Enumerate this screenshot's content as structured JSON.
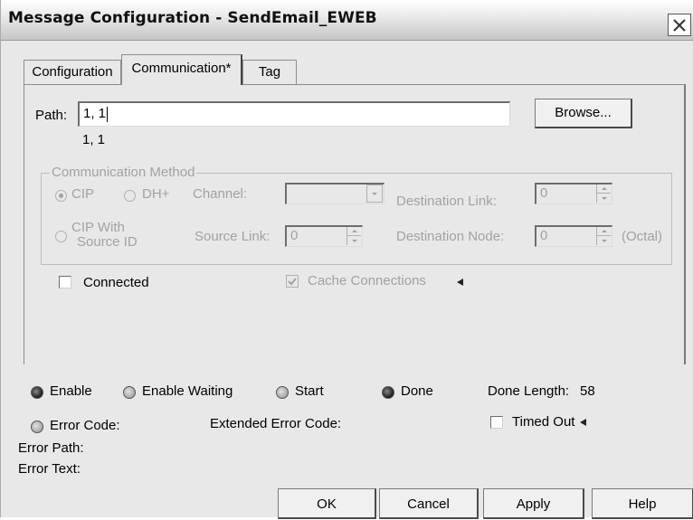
{
  "window": {
    "title": "Message Configuration - SendEmail_EWEB",
    "close_icon": "close-x-icon"
  },
  "tabs": [
    {
      "label": "Configuration",
      "active": false
    },
    {
      "label": "Communication*",
      "active": true
    },
    {
      "label": "Tag",
      "active": false
    }
  ],
  "path": {
    "label": "Path:",
    "value": "1, 1",
    "resolved": "1, 1",
    "browse_label": "Browse..."
  },
  "comm_method": {
    "legend": "Communication Method",
    "cip_label": "CIP",
    "dhplus_label": "DH+",
    "channel_label": "Channel:",
    "channel_value": "",
    "dest_link_label": "Destination Link:",
    "dest_link_value": "0",
    "cip_sourceid_line1": "CIP With",
    "cip_sourceid_line2": "Source ID",
    "source_link_label": "Source Link:",
    "source_link_value": "0",
    "dest_node_label": "Destination Node:",
    "dest_node_value": "0",
    "octal_label": "(Octal)",
    "selected": "CIP"
  },
  "connected": {
    "label": "Connected",
    "checked": false
  },
  "cache": {
    "label": "Cache Connections",
    "checked": true,
    "arrow_icon": "arrow-left-icon"
  },
  "status": {
    "enable_label": "Enable",
    "enable_on": true,
    "enable_waiting_label": "Enable Waiting",
    "enable_waiting_on": false,
    "start_label": "Start",
    "start_on": false,
    "done_label": "Done",
    "done_on": true,
    "done_length_label": "Done Length:",
    "done_length_value": "58",
    "error_code_label": "Error Code:",
    "error_code_on": false,
    "extended_error_label": "Extended Error Code:",
    "timed_out_label": "Timed Out",
    "timed_out_checked": false,
    "error_path_label": "Error Path:",
    "error_text_label": "Error Text:"
  },
  "buttons": {
    "ok": "OK",
    "cancel": "Cancel",
    "apply": "Apply",
    "help": "Help"
  },
  "colors": {
    "disabled_text": "#a2a2a2",
    "dialog_bg": "#e8e8e8",
    "led_on": "#1a1a1a",
    "led_off": "#b5b5b5"
  }
}
